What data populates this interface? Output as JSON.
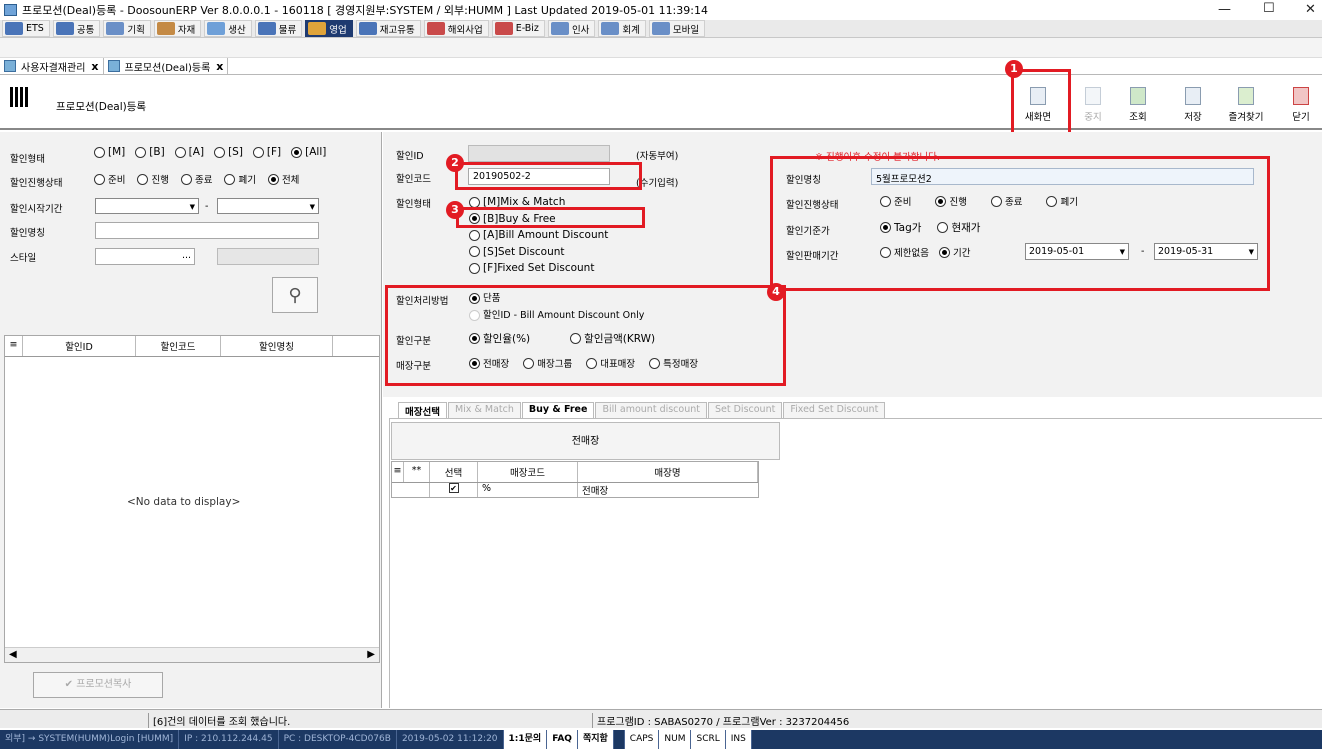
{
  "window": {
    "title": "프로모션(Deal)등록 - DoosounERP Ver 8.0.0.0.1 - 160118 [ 경영지원부:SYSTEM / 외부:HUMM ]    Last Updated 2019-05-01 11:39:14",
    "minimize": "—",
    "maximize": "☐",
    "close": "✕"
  },
  "menu": [
    {
      "label": "ETS",
      "color": "#4a74b8"
    },
    {
      "label": "공통",
      "color": "#4a74b8"
    },
    {
      "label": "기획",
      "color": "#6a8fc7"
    },
    {
      "label": "자재",
      "color": "#c48a45"
    },
    {
      "label": "생산",
      "color": "#6fa0d8"
    },
    {
      "label": "물류",
      "color": "#4a74b8"
    },
    {
      "label": "영업",
      "color": "#e0a43a",
      "active": true
    },
    {
      "label": "재고유통",
      "color": "#4a74b8"
    },
    {
      "label": "해외사업",
      "color": "#c94a4a"
    },
    {
      "label": "E-Biz",
      "color": "#c94a4a"
    },
    {
      "label": "인사",
      "color": "#6a8fc7"
    },
    {
      "label": "회계",
      "color": "#6a8fc7"
    },
    {
      "label": "모바일",
      "color": "#6a8fc7"
    }
  ],
  "doctabs": [
    "사용자결재관리",
    "프로모션(Deal)등록"
  ],
  "tab_close": "x",
  "header": {
    "title": "프로모션(Deal)등록"
  },
  "toolbar": [
    {
      "label": "새화면",
      "enabled": true
    },
    {
      "label": "중지",
      "enabled": false
    },
    {
      "label": "조회",
      "enabled": true
    },
    {
      "label": "저장",
      "enabled": true
    },
    {
      "label": "즐겨찾기",
      "enabled": true
    },
    {
      "label": "닫기",
      "enabled": true
    }
  ],
  "search": {
    "type_label": "할인형태",
    "type_options": [
      "[M]",
      "[B]",
      "[A]",
      "[S]",
      "[F]",
      "[All]"
    ],
    "status_label": "할인진행상태",
    "status_options": [
      "준비",
      "진행",
      "종료",
      "폐기",
      "전체"
    ],
    "period_label": "할인시작기간",
    "period_sep": "-",
    "name_label": "할인명칭",
    "style_label": "스타일",
    "style_btn": "..."
  },
  "list": {
    "cols": [
      "할인ID",
      "할인코드",
      "할인명칭"
    ],
    "empty": "<No data to display>",
    "copy_button": "프로모션복사"
  },
  "detail": {
    "id_label": "할인ID",
    "id_note": "(자동부여)",
    "code_label": "할인코드",
    "code_value": "20190502-2",
    "code_note": "(수기입력)",
    "type_label": "할인형태",
    "type_options": [
      "[M]Mix & Match",
      "[B]Buy & Free",
      "[A]Bill Amount Discount",
      "[S]Set Discount",
      "[F]Fixed Set Discount"
    ],
    "warning": "※ 진행이후 수정이 불가합니다.",
    "name_label": "할인명칭",
    "name_value": "5월프로모션2",
    "status_label": "할인진행상태",
    "status_options": [
      "준비",
      "진행",
      "종료",
      "폐기"
    ],
    "price_label": "할인기준가",
    "price_options": [
      "Tag가",
      "현재가"
    ],
    "sale_period_label": "할인판매기간",
    "sale_period_options": [
      "제한없음",
      "기간"
    ],
    "date_from": "2019-05-01",
    "date_to": "2019-05-31",
    "date_sep": "-",
    "method_label": "할인처리방법",
    "method_options": [
      "단품",
      "할인ID - Bill Amount Discount Only"
    ],
    "kind_label": "할인구분",
    "kind_options": [
      "할인율(%)",
      "할인금액(KRW)"
    ],
    "store_label": "매장구분",
    "store_options": [
      "전매장",
      "매장그룹",
      "대표매장",
      "특정매장"
    ]
  },
  "subtabs": [
    "매장선택",
    "Mix & Match",
    "Buy & Free",
    "Bill amount discount",
    "Set Discount",
    "Fixed Set Discount"
  ],
  "store": {
    "header": "전매장",
    "cols": [
      "**",
      "선택",
      "매장코드",
      "매장명"
    ],
    "row": {
      "code": "%",
      "name": "전매장"
    }
  },
  "badges": [
    "1",
    "2",
    "3",
    "4"
  ],
  "status": {
    "message": "[6]건의 데이터를 조회 했습니다.",
    "program": "프로그램ID : SABAS0270 / 프로그램Ver : 3237204456"
  },
  "taskbar": [
    "외부] → SYSTEM(HUMM)Login [HUMM]",
    "IP : 210.112.244.45",
    "PC : DESKTOP-4CD076B",
    "2019-05-02 11:12:20",
    "1:1문의",
    "FAQ",
    "쪽지함",
    "",
    "CAPS",
    "NUM",
    "SCRL",
    "INS"
  ]
}
